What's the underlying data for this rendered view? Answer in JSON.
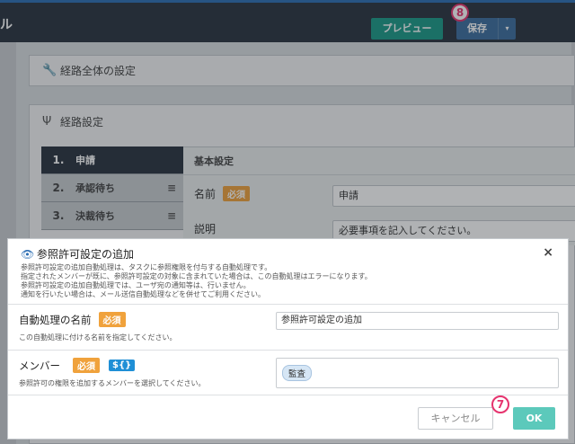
{
  "header": {
    "title_fragment": "ル",
    "preview_label": "プレビュー",
    "save_label": "保存",
    "save_caret": "▾"
  },
  "badges": {
    "save_marker": "8",
    "ok_marker": "7"
  },
  "panels": {
    "route_all_settings": "経路全体の設定",
    "route_settings": "経路設定"
  },
  "steps": [
    {
      "num": "1.",
      "label": "申請"
    },
    {
      "num": "2.",
      "label": "承認待ち"
    },
    {
      "num": "3.",
      "label": "決裁待ち"
    }
  ],
  "basic_settings": {
    "heading": "基本設定",
    "name_label": "名前",
    "required_label": "必須",
    "name_value": "申請",
    "description_label": "説明",
    "description_value": "必要事項を記入してください。"
  },
  "modal": {
    "title": "参照許可設定の追加",
    "close": "×",
    "description_lines": [
      "参照許可設定の追加自動処理は、タスクに参照権限を付与する自動処理です。",
      "指定されたメンバーが既に、参照許可設定の対象に含まれていた場合は、この自動処理はエラーになります。",
      "参照許可設定の追加自動処理では、ユーザ宛の通知等は、行いません。",
      "通知を行いたい場合は、メール送信自動処理などを併せてご利用ください。"
    ],
    "name_field": {
      "label": "自動処理の名前",
      "required": "必須",
      "value": "参照許可設定の追加",
      "help": "この自動処理に付ける名前を指定してください。"
    },
    "member_field": {
      "label": "メンバー",
      "required": "必須",
      "variable": "${}",
      "chip": "監査",
      "help": "参照許可の権限を追加するメンバーを選択してください。"
    },
    "cancel_label": "キャンセル",
    "ok_label": "OK"
  },
  "icons": {
    "wrench": "wrench-icon",
    "route": "route-icon",
    "eye": "eye-icon",
    "grip": "drag-handle-icon",
    "close": "close-icon"
  },
  "colors": {
    "topbar": "#2a3340",
    "preview": "#1b9a88",
    "save": "#3d6d9e",
    "required": "#f0a23c",
    "variable": "#1f8fd6",
    "ok": "#5cc9bb",
    "marker": "#e6336e"
  }
}
